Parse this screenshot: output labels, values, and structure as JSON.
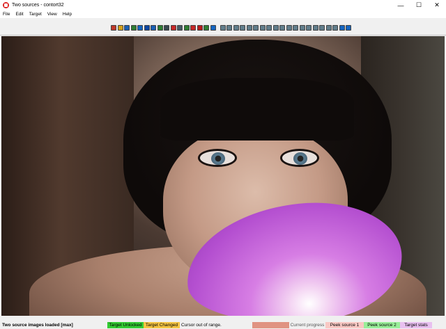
{
  "window": {
    "title": "Two sources - contort32",
    "icon": "app-icon",
    "controls": [
      {
        "name": "minimize-button",
        "glyph": "—"
      },
      {
        "name": "maximize-button",
        "glyph": "☐"
      },
      {
        "name": "close-button",
        "glyph": "✕"
      }
    ]
  },
  "menu": [
    "File",
    "Edit",
    "Target",
    "View",
    "Help"
  ],
  "toolbar": {
    "icon_colors": [
      "#c0392b",
      "#d4a017",
      "#1a5fb4",
      "#2e7d32",
      "#1565c0",
      "#0d47a1",
      "#1a5fb4",
      "#2e7d32",
      "#37474f",
      "#c62828",
      "#455a64",
      "#2e7d32",
      "#c62828",
      "#b71c1c",
      "#2e7d32",
      "#1565c0",
      "#607d8b",
      "#607d8b",
      "#607d8b",
      "#607d8b",
      "#607d8b",
      "#607d8b",
      "#607d8b",
      "#607d8b",
      "#607d8b",
      "#607d8b",
      "#607d8b",
      "#607d8b",
      "#607d8b",
      "#607d8b",
      "#607d8b",
      "#607d8b",
      "#607d8b",
      "#607d8b",
      "#1565c0",
      "#1565c0"
    ]
  },
  "status": {
    "loaded": "Two source images loaded [max]",
    "unlocked": "Target Unlocked",
    "unlocked_color": "#33cc33",
    "changed": "Target Changed",
    "changed_color": "#f5c542",
    "cursor": "Cursor out of range.",
    "progress_bar_color": "#e09382",
    "progress_label": "Current progress",
    "peek1": "Peek source 1",
    "peek1_color": "#f9c8c4",
    "peek2": "Peek source 2",
    "peek2_color": "#99ee99",
    "stats": "Target stats",
    "stats_color": "#e8c0f0"
  }
}
